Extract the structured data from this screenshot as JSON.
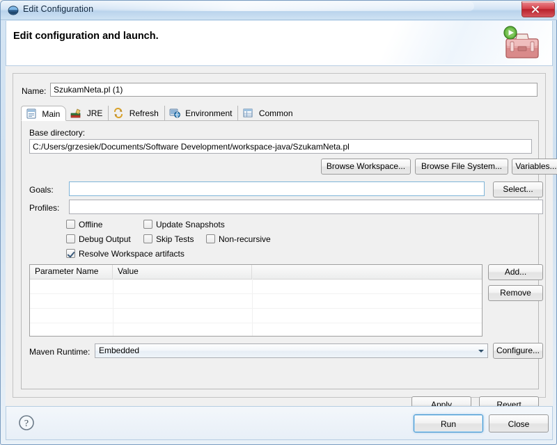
{
  "window": {
    "title": "Edit Configuration",
    "title_icon": "eclipse-icon",
    "close_label": "Close window"
  },
  "header": {
    "title": "Edit configuration and launch.",
    "icon": "maven-toolbox-run-icon"
  },
  "name_field": {
    "label": "Name:",
    "value": "SzukamNeta.pl (1)"
  },
  "tabs": [
    {
      "label": "Main",
      "icon": "main-document-icon",
      "selected": true
    },
    {
      "label": "JRE",
      "icon": "jre-books-icon",
      "selected": false
    },
    {
      "label": "Refresh",
      "icon": "refresh-arrows-icon",
      "selected": false
    },
    {
      "label": "Environment",
      "icon": "environment-icon",
      "selected": false
    },
    {
      "label": "Common",
      "icon": "common-table-icon",
      "selected": false
    }
  ],
  "main_tab": {
    "base_directory": {
      "label": "Base directory:",
      "value": "C:/Users/grzesiek/Documents/Software Development/workspace-java/SzukamNeta.pl"
    },
    "browse_buttons": [
      {
        "label": "Browse Workspace..."
      },
      {
        "label": "Browse File System..."
      },
      {
        "label": "Variables..."
      }
    ],
    "goals": {
      "label": "Goals:",
      "value": "",
      "button": "Select..."
    },
    "profiles": {
      "label": "Profiles:",
      "value": ""
    },
    "options": [
      {
        "label": "Offline",
        "checked": false
      },
      {
        "label": "Update Snapshots",
        "checked": false
      },
      {
        "label": "Debug Output",
        "checked": false
      },
      {
        "label": "Skip Tests",
        "checked": false
      },
      {
        "label": "Non-recursive",
        "checked": false
      },
      {
        "label": "Resolve Workspace artifacts",
        "checked": true
      }
    ],
    "parameters_table": {
      "columns": [
        "Parameter Name",
        "Value",
        ""
      ],
      "rows": [],
      "empty_row_count": 5,
      "add_button": "Add...",
      "remove_button": "Remove"
    },
    "maven_runtime": {
      "label": "Maven Runtime:",
      "selected": "Embedded",
      "options": [
        "Embedded"
      ],
      "configure_button": "Configure..."
    }
  },
  "form_buttons": {
    "apply": "Apply",
    "revert": "Revert"
  },
  "bottom_bar": {
    "help_icon": "help-question-icon",
    "run": "Run",
    "close": "Close"
  },
  "colors": {
    "accent": "#4f9ed0",
    "close_red": "#b9212c",
    "toolbox_red": "#d98a8a",
    "play_green": "#4ea832"
  }
}
